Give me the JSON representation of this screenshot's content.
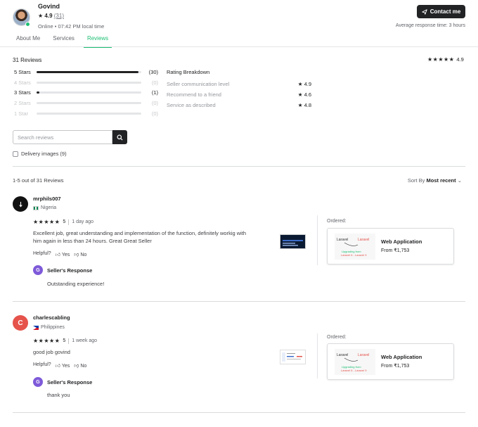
{
  "seller": {
    "name": "Govind",
    "rating": "4.9",
    "rating_count": "(31)",
    "status": "Online • 07:42 PM local time",
    "contact_label": "Contact me",
    "response_time": "Average response time: 3 hours"
  },
  "tabs": [
    "About Me",
    "Services",
    "Reviews"
  ],
  "summary": {
    "total": "31 Reviews",
    "overall_rating": "4.9",
    "bars": [
      {
        "label": "5 Stars",
        "count": "(30)",
        "fraction": 0.97
      },
      {
        "label": "4 Stars",
        "count": "(0)",
        "fraction": 0
      },
      {
        "label": "3 Stars",
        "count": "(1)",
        "fraction": 0.03
      },
      {
        "label": "2 Stars",
        "count": "(0)",
        "fraction": 0
      },
      {
        "label": "1 Star",
        "count": "(0)",
        "fraction": 0
      }
    ],
    "breakdown_title": "Rating Breakdown",
    "breakdown": [
      {
        "label": "Seller communication level",
        "value": "4.9"
      },
      {
        "label": "Recommend to a friend",
        "value": "4.6"
      },
      {
        "label": "Service as described",
        "value": "4.8"
      }
    ]
  },
  "search": {
    "placeholder": "Search reviews"
  },
  "filter": {
    "delivery_images": "Delivery images (9)"
  },
  "list": {
    "count": "1-5 out of 31 Reviews",
    "sort_label": "Sort By",
    "sort_value": "Most recent"
  },
  "reviews": [
    {
      "initial": "",
      "avatar_color": "#111111",
      "name": "mrphils007",
      "country": "Nigeria",
      "rating": "5",
      "time": "1 day ago",
      "text_line1": "Excellent job, great understanding and implementation of the function, definitely workig with",
      "text_line2": "him again in less than 24 hours. Great Great Seller",
      "helpful": "Helpful?",
      "yes": "Yes",
      "no": "No",
      "ordered": "Ordered:",
      "order_title": "Web Application",
      "order_price": "From ₹1,753",
      "response_initial": "G",
      "response_title": "Seller's Response",
      "response_text": "Outstanding experience!"
    },
    {
      "initial": "C",
      "avatar_color": "#e5534b",
      "name": "charlescabling",
      "country": "Philippines",
      "rating": "5",
      "time": "1 week ago",
      "text_line1": "good job govind",
      "text_line2": "",
      "helpful": "Helpful?",
      "yes": "Yes",
      "no": "No",
      "ordered": "Ordered:",
      "order_title": "Web Application",
      "order_price": "From ₹1,753",
      "response_initial": "G",
      "response_title": "Seller's Response",
      "response_text": "thank you"
    }
  ],
  "icons": {
    "star": "★",
    "send": "paper-plane-icon",
    "search": "search-icon",
    "thumb_up": "thumb-up-icon",
    "thumb_down": "thumb-down-icon",
    "chevron": "chevron-down-icon"
  },
  "colors": {
    "accent": "#1dbf73",
    "dark": "#222325"
  }
}
